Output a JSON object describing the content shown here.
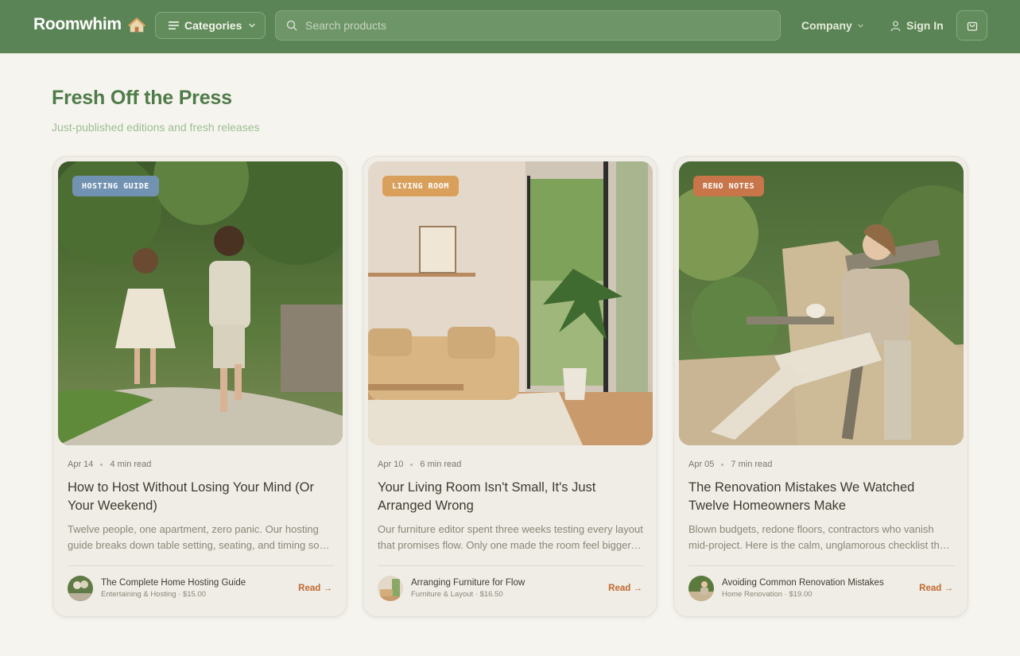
{
  "header": {
    "logo": "Roomwhim",
    "categories_label": "Categories",
    "search_placeholder": "Search products",
    "company_label": "Company",
    "signin_label": "Sign In"
  },
  "section": {
    "title": "Fresh Off the Press",
    "subtitle": "Just-published editions and fresh releases"
  },
  "colors": {
    "header_bg": "#5a8455",
    "title": "#4f7b49",
    "read_link": "#c0692f",
    "badge_hosting": "#7292b2",
    "badge_living": "#d9a05c",
    "badge_reno": "#c8754a"
  },
  "cards": [
    {
      "badge": "HOSTING GUIDE",
      "date": "Apr 14",
      "read_time": "4 min read",
      "title": "How to Host Without Losing Your Mind (Or Your Weekend)",
      "excerpt": "Twelve people, one apartment, zero panic. Our hosting guide breaks down table setting, seating, and timing so you can actually enjoy your own party.",
      "product": "The Complete Home Hosting Guide",
      "product_meta": "Entertaining & Hosting · $15.00",
      "read": "Read →"
    },
    {
      "badge": "LIVING ROOM",
      "date": "Apr 10",
      "read_time": "6 min read",
      "title": "Your Living Room Isn't Small, It's Just Arranged Wrong",
      "excerpt": "Our furniture editor spent three weeks testing every layout that promises flow. Only one made the room feel bigger without buying anything new.",
      "product": "Arranging Furniture for Flow",
      "product_meta": "Furniture & Layout · $16.50",
      "read": "Read →"
    },
    {
      "badge": "RENO NOTES",
      "date": "Apr 05",
      "read_time": "7 min read",
      "title": "The Renovation Mistakes We Watched Twelve Homeowners Make",
      "excerpt": "Blown budgets, redone floors, contractors who vanish mid-project. Here is the calm, unglamorous checklist that would have saved them all.",
      "product": "Avoiding Common Renovation Mistakes",
      "product_meta": "Home Renovation · $19.00",
      "read": "Read →"
    }
  ]
}
